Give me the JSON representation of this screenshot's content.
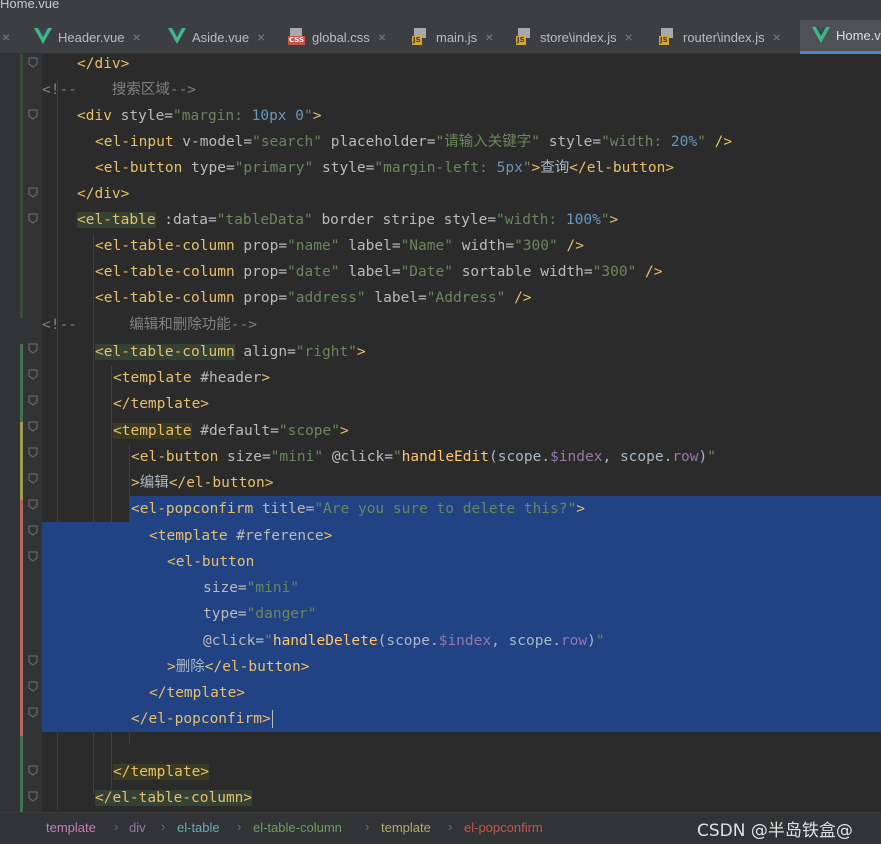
{
  "window": {
    "title": "Home.vue"
  },
  "tabs": [
    {
      "label": "Header.vue",
      "type": "vue",
      "active": false
    },
    {
      "label": "Aside.vue",
      "type": "vue",
      "active": false
    },
    {
      "label": "global.css",
      "type": "css",
      "active": false
    },
    {
      "label": "main.js",
      "type": "js",
      "active": false
    },
    {
      "label": "store\\index.js",
      "type": "js",
      "active": false
    },
    {
      "label": "router\\index.js",
      "type": "js",
      "active": false
    },
    {
      "label": "Home.v",
      "type": "vue",
      "active": true
    }
  ],
  "tab_close_glyph": "×",
  "file_badges": {
    "css": "CSS",
    "js": "JS"
  },
  "colors": {
    "accent": "#4a88c7",
    "selection": "#214283",
    "tag": "#e8bf6a",
    "string": "#6a8759",
    "number": "#6897bb",
    "comment": "#808080"
  },
  "code": {
    "l1": "</div>",
    "l2_comment": "<!--    搜索区域-->",
    "l3": {
      "open": "<div",
      "attr": " style=",
      "val": "\"margin: ",
      "num": "10px 0",
      "end": "\"",
      "close": ">"
    },
    "l4": {
      "tag": "<el-input",
      "a1": " v-model=",
      "v1": "\"search\"",
      "a2": " placeholder=",
      "v2": "\"请输入关键字\"",
      "a3": " style=",
      "v3a": "\"width: ",
      "v3n": "20%",
      "v3b": "\"",
      "close": " />"
    },
    "l5": {
      "tag": "<el-button",
      "a1": " type=",
      "v1": "\"primary\"",
      "a2": " style=",
      "v2a": "\"margin-left: ",
      "v2n": "5px",
      "v2b": "\"",
      "gt": ">",
      "text": "查询",
      "end": "</el-button>"
    },
    "l6": "</div>",
    "l7": {
      "tag": "<el-table",
      "a1": " :data=",
      "v1": "\"tableData\"",
      "a2": " border stripe style=",
      "v2a": "\"width: ",
      "v2n": "100%",
      "v2b": "\"",
      "close": ">"
    },
    "l8": {
      "tag": "<el-table-column",
      "a1": " prop=",
      "v1": "\"name\"",
      "a2": " label=",
      "v2": "\"Name\"",
      "a3": " width=",
      "v3": "\"300\"",
      "close": " />"
    },
    "l9": {
      "tag": "<el-table-column",
      "a1": " prop=",
      "v1": "\"date\"",
      "a2": " label=",
      "v2": "\"Date\"",
      "a3": " sortable width=",
      "v3": "\"300\"",
      "close": " />"
    },
    "l10": {
      "tag": "<el-table-column",
      "a1": " prop=",
      "v1": "\"address\"",
      "a2": " label=",
      "v2": "\"Address\"",
      "close": " />"
    },
    "l11_comment": "<!--      编辑和删除功能-->",
    "l12": {
      "tag": "<el-table-column",
      "a1": " align=",
      "v1": "\"right\"",
      "close": ">"
    },
    "l13": {
      "tag": "<template",
      "a1": " #header",
      "close": ">"
    },
    "l14": "</template>",
    "l15": {
      "tag": "<template",
      "a1": " #default=",
      "v1": "\"scope\"",
      "close": ">"
    },
    "l16": {
      "tag": "<el-button",
      "a1": " size=",
      "v1": "\"mini\"",
      "a2": " @click=",
      "q1": "\"",
      "m": "handleEdit",
      "p1": "(scope.",
      "pv": "$index",
      "p2": ", scope.",
      "pr": "row",
      "p3": ")",
      "q2": "\""
    },
    "l17": {
      "gt": ">",
      "text": "编辑",
      "end": "</el-button>"
    },
    "l18": {
      "tag": "<el-popconfirm",
      "a1": " title=",
      "v1": "\"Are you sure to delete this?\"",
      "close": ">"
    },
    "l19": {
      "tag": "<template",
      "a1": " #reference",
      "close": ">"
    },
    "l20": "<el-button",
    "l21": {
      "a1": "size=",
      "v1": "\"mini\""
    },
    "l22": {
      "a1": "type=",
      "v1": "\"danger\""
    },
    "l23": {
      "a1": "@click=",
      "q1": "\"",
      "m": "handleDelete",
      "p1": "(scope.",
      "pv": "$index",
      "p2": ", scope.",
      "pr": "row",
      "p3": ")",
      "q2": "\""
    },
    "l24": {
      "gt": ">",
      "text": "删除",
      "end": "</el-button>"
    },
    "l25": "</template>",
    "l26": "</el-popconfirm>",
    "l28": "</template>",
    "l29": "</el-table-column>"
  },
  "breadcrumb": [
    {
      "label": "template",
      "color": "#c77dbb"
    },
    {
      "label": "div",
      "color": "#9876aa"
    },
    {
      "label": "el-table",
      "color": "#6aaab5"
    },
    {
      "label": "el-table-column",
      "color": "#6a9f5f"
    },
    {
      "label": "template",
      "color": "#b5a86a"
    },
    {
      "label": "el-popconfirm",
      "color": "#c75450"
    }
  ],
  "breadcrumb_separator": "›",
  "watermark": "CSDN @半岛铁盒@"
}
